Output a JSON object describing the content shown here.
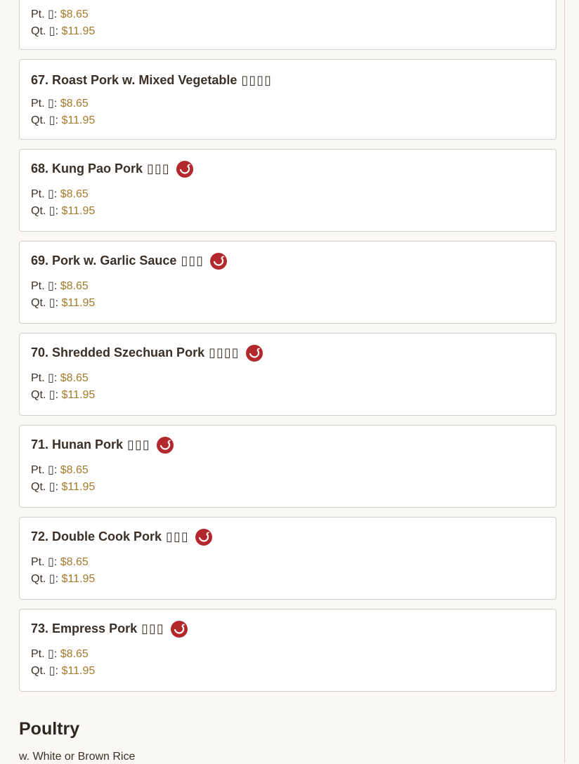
{
  "items": [
    {
      "number_name": "",
      "chinese": "",
      "spicy": false,
      "pt_label": "Pt. ▯:",
      "pt_price": "$8.65",
      "qt_label": "Qt. ▯:",
      "qt_price": "$11.95"
    },
    {
      "number_name": "67. Roast Pork w. Mixed Vegetable",
      "chinese": "▯▯▯▯",
      "spicy": false,
      "pt_label": "Pt. ▯:",
      "pt_price": "$8.65",
      "qt_label": "Qt. ▯:",
      "qt_price": "$11.95"
    },
    {
      "number_name": "68. Kung Pao Pork",
      "chinese": "▯▯▯",
      "spicy": true,
      "pt_label": "Pt. ▯:",
      "pt_price": "$8.65",
      "qt_label": "Qt. ▯:",
      "qt_price": "$11.95"
    },
    {
      "number_name": "69. Pork w. Garlic Sauce",
      "chinese": "▯▯▯",
      "spicy": true,
      "pt_label": "Pt. ▯:",
      "pt_price": "$8.65",
      "qt_label": "Qt. ▯:",
      "qt_price": "$11.95"
    },
    {
      "number_name": "70. Shredded Szechuan Pork",
      "chinese": "▯▯▯▯",
      "spicy": true,
      "pt_label": "Pt. ▯:",
      "pt_price": "$8.65",
      "qt_label": "Qt. ▯:",
      "qt_price": "$11.95"
    },
    {
      "number_name": "71. Hunan Pork",
      "chinese": "▯▯▯",
      "spicy": true,
      "pt_label": "Pt. ▯:",
      "pt_price": "$8.65",
      "qt_label": "Qt. ▯:",
      "qt_price": "$11.95"
    },
    {
      "number_name": "72. Double Cook Pork",
      "chinese": "▯▯▯",
      "spicy": true,
      "pt_label": "Pt. ▯:",
      "pt_price": "$8.65",
      "qt_label": "Qt. ▯:",
      "qt_price": "$11.95"
    },
    {
      "number_name": "73. Empress Pork",
      "chinese": "▯▯▯",
      "spicy": true,
      "pt_label": "Pt. ▯:",
      "pt_price": "$8.65",
      "qt_label": "Qt. ▯:",
      "qt_price": "$11.95"
    }
  ],
  "section": {
    "title": "Poultry",
    "subtitle": "w. White or Brown Rice"
  },
  "colors": {
    "price": "#a47a2c",
    "spicy_icon": "#b3282d",
    "card_border": "#d4d1cd"
  },
  "icons": {
    "spicy": "chili-pepper-icon"
  }
}
